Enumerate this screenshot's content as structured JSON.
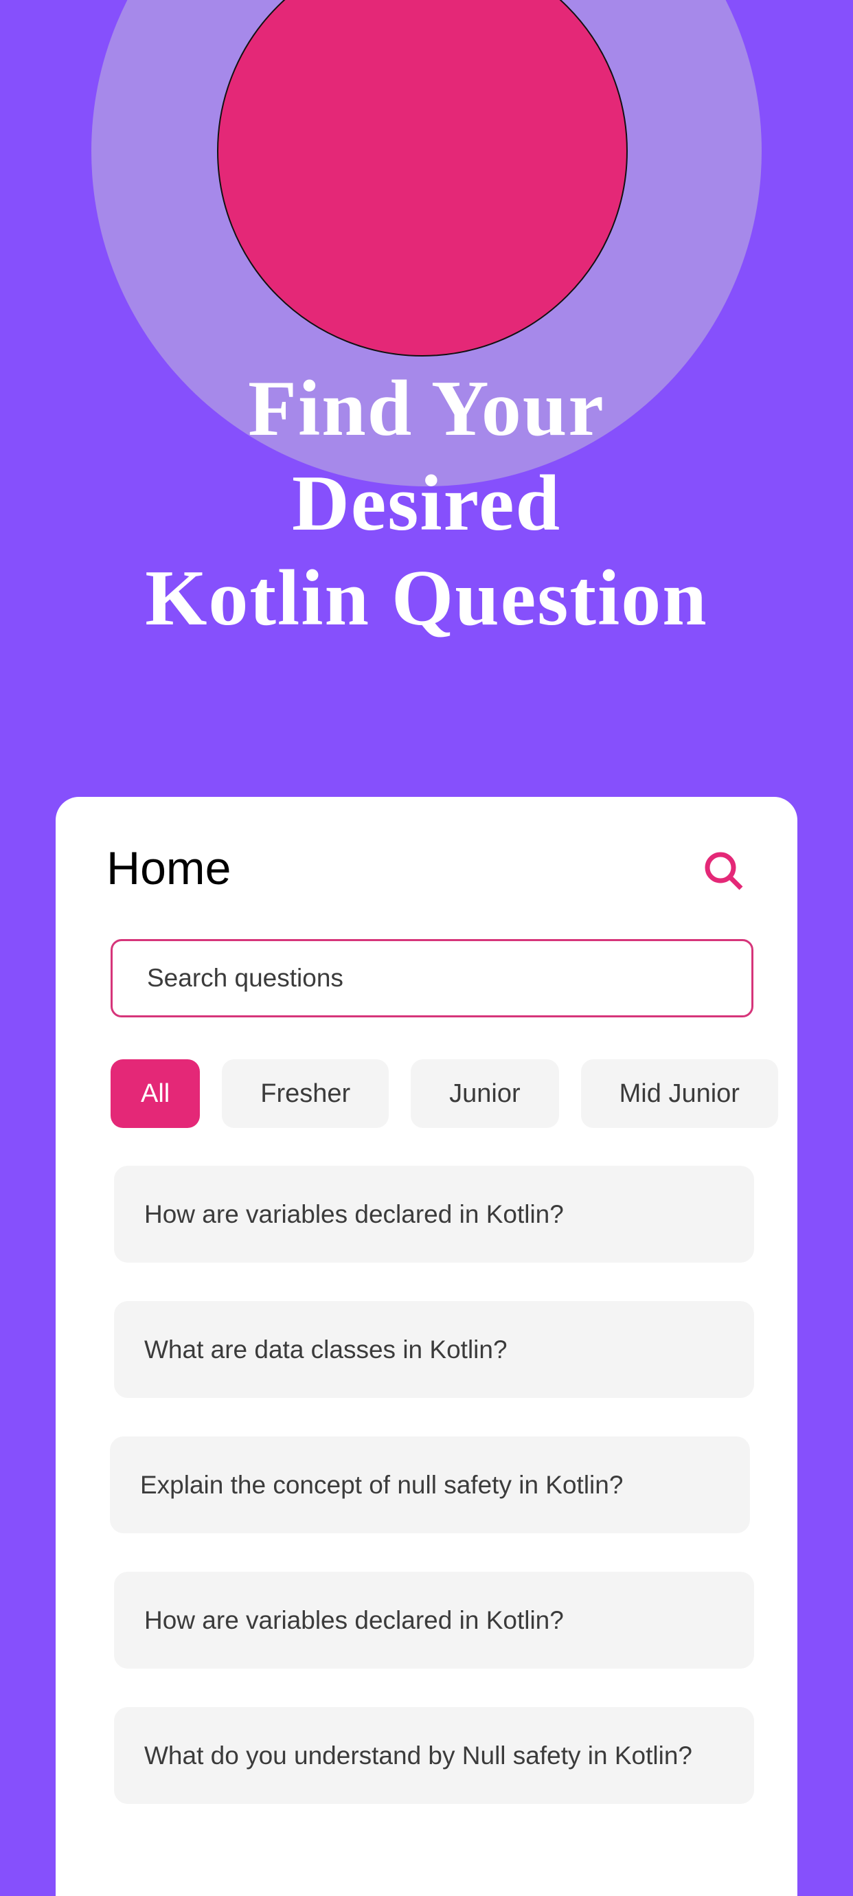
{
  "colors": {
    "background": "#8650fc",
    "halo": "#a689ea",
    "accent": "#e42877",
    "input_border": "#d6357a",
    "chip_bg": "#f4f4f4",
    "text": "#3b3b3b"
  },
  "hero": {
    "title_lines": [
      "Find Your",
      "Desired",
      "Kotlin Question"
    ]
  },
  "header": {
    "title": "Home",
    "search_icon": "search-icon"
  },
  "search": {
    "placeholder": "Search questions",
    "value": ""
  },
  "filters": {
    "selected": "All",
    "chips": [
      {
        "label": "All",
        "active": true
      },
      {
        "label": "Fresher",
        "active": false
      },
      {
        "label": "Junior",
        "active": false
      },
      {
        "label": "Mid Junior",
        "active": false
      }
    ]
  },
  "questions": [
    {
      "text": "How are variables declared in Kotlin?"
    },
    {
      "text": "What are data classes in Kotlin?"
    },
    {
      "text": "Explain the concept of null safety in Kotlin?"
    },
    {
      "text": "How are variables declared in Kotlin?"
    },
    {
      "text": "What do you understand by Null safety in Kotlin?"
    }
  ]
}
